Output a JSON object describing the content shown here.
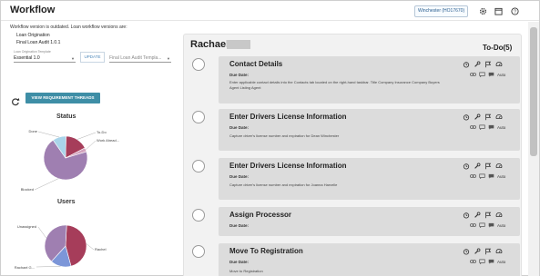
{
  "header": {
    "title": "Workflow",
    "workflow_badge": "Winchester (HO17670)",
    "icons": [
      "gear-icon",
      "calendar-icon",
      "help-icon"
    ]
  },
  "left": {
    "outdated_message": "Workflow version is outdated. Loan workflow versions are:",
    "versions": [
      "Loan Origination",
      "Final Loan Audit 1.0.1"
    ],
    "template_label": "Loan Origination Template",
    "template_select": "Essential 1.0",
    "update_label": "UPDATE",
    "audit_select_placeholder": "Final Loan Audit Templa...",
    "view_button": "VIEW REQUIREMENT THREADS",
    "status_chart_title": "Status",
    "users_chart_title": "Users"
  },
  "colors": {
    "done": "#a9d4ea",
    "todo": "#a63d5a",
    "work_ahead": "#d3a3bd",
    "blocked": "#9f7fb1",
    "unassigned": "#9f7fb1",
    "user_a": "#a63d5a",
    "user_b": "#7c96d8",
    "accent": "#3e8ea6"
  },
  "chart_data": [
    {
      "type": "pie",
      "title": "Status",
      "slices": [
        {
          "label": "To-Do",
          "value": 17,
          "color": "#a63d5a"
        },
        {
          "label": "Work Ahead...",
          "value": 3,
          "color": "#d3a3bd"
        },
        {
          "label": "Blocked",
          "value": 70,
          "color": "#9f7fb1"
        },
        {
          "label": "Done",
          "value": 10,
          "color": "#a9d4ea"
        }
      ]
    },
    {
      "type": "pie",
      "title": "Users",
      "slices": [
        {
          "label": "Rachel",
          "value": 45,
          "color": "#a63d5a"
        },
        {
          "label": "Rachael G...",
          "value": 16,
          "color": "#7c96d8"
        },
        {
          "label": "Unassigned",
          "value": 39,
          "color": "#9f7fb1"
        }
      ]
    }
  ],
  "main": {
    "user_name": "Rachael",
    "todo_label": "To-Do(5)",
    "due_label": "Due Date:",
    "auto_label": "Auto",
    "tasks": [
      {
        "title": "Contact Details",
        "desc": "Enter applicable contact details into the Contacts tab located on the right-hand taskbar. Title Company Insurance Company Buyers Agent Listing Agent"
      },
      {
        "title": "Enter Drivers License Information",
        "desc": "Capture driver's license number and expiration for Dean Winchester"
      },
      {
        "title": "Enter Drivers License Information",
        "desc": "Capture driver's license number and expiration for Joanna Harvelle"
      },
      {
        "title": "Assign Processor",
        "desc": ""
      },
      {
        "title": "Move To Registration",
        "desc": "Move to Registration"
      }
    ]
  }
}
